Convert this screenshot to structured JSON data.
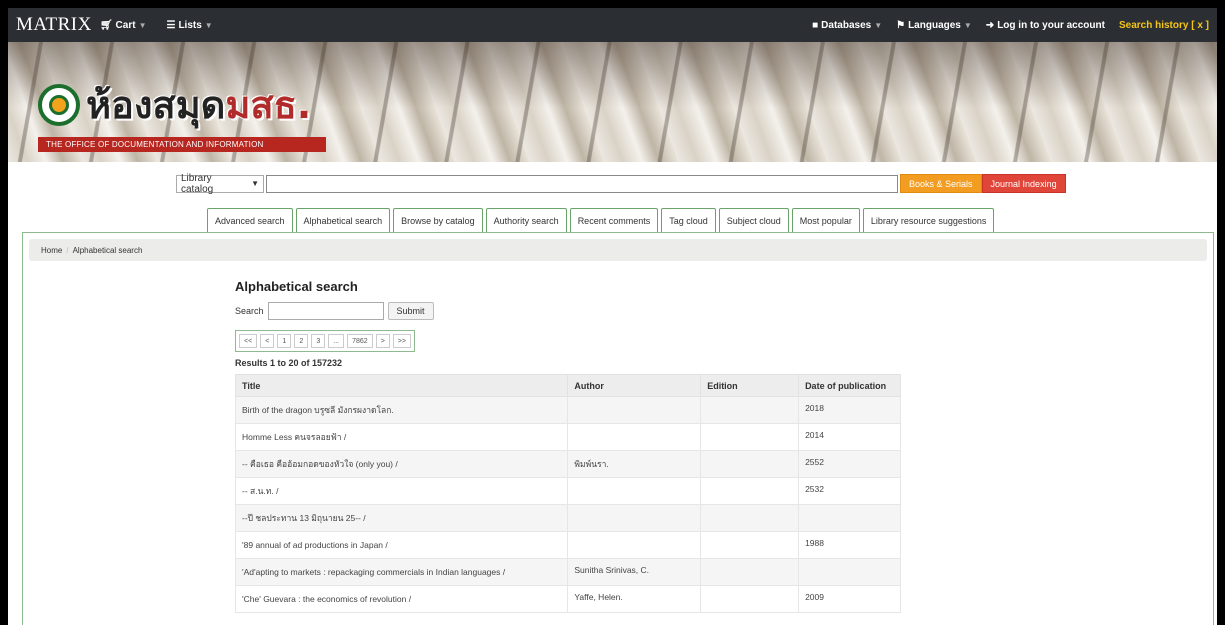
{
  "navbar": {
    "brand": "MATRIX",
    "cart": "Cart",
    "lists": "Lists",
    "databases": "Databases",
    "languages": "Languages",
    "login": "Log in to your account",
    "search_history": "Search history [ x ]"
  },
  "banner": {
    "logo_text": "ห้องสมุด",
    "logo_accent": "มสธ.",
    "logo_sub": "THE OFFICE OF DOCUMENTATION AND INFORMATION"
  },
  "search": {
    "catalog_select": "Library catalog",
    "query": "",
    "books_button": "Books & Serials",
    "journal_button": "Journal Indexing"
  },
  "tabs": [
    "Advanced search",
    "Alphabetical search",
    "Browse by catalog",
    "Authority search",
    "Recent comments",
    "Tag cloud",
    "Subject cloud",
    "Most popular",
    "Library resource suggestions"
  ],
  "breadcrumb": {
    "home": "Home",
    "current": "Alphabetical search"
  },
  "page": {
    "title": "Alphabetical search",
    "search_label": "Search",
    "search_value": "",
    "submit": "Submit",
    "results": "Results 1 to 20 of 157232"
  },
  "pager": [
    "<<",
    "<",
    "1",
    "2",
    "3",
    "...",
    "7862",
    ">",
    ">>"
  ],
  "table": {
    "headers": {
      "title": "Title",
      "author": "Author",
      "edition": "Edition",
      "date": "Date of publication"
    },
    "rows": [
      {
        "title": "Birth of the dragon บรูซลี มังกรผงาดโลก.",
        "author": "",
        "edition": "",
        "date": "2018"
      },
      {
        "title": "Homme Less คนจรลอยฟ้า /",
        "author": "",
        "edition": "",
        "date": "2014"
      },
      {
        "title": "-- คือเธอ คืออ้อมกอดของหัวใจ (only you) /",
        "author": "พิมพ์นรา.",
        "edition": "",
        "date": "2552"
      },
      {
        "title": "-- ส.น.ท. /",
        "author": "",
        "edition": "",
        "date": "2532"
      },
      {
        "title": "--ปี ชลประทาน 13 มิถุนายน 25-- /",
        "author": "",
        "edition": "",
        "date": ""
      },
      {
        "title": "'89 annual of ad productions in Japan /",
        "author": "",
        "edition": "",
        "date": "1988"
      },
      {
        "title": "'Ad'apting to markets : repackaging commercials in Indian languages /",
        "author": "Sunitha Srinivas, C.",
        "edition": "",
        "date": ""
      },
      {
        "title": "'Che' Guevara : the economics of revolution /",
        "author": "Yaffe, Helen.",
        "edition": "",
        "date": "2009"
      }
    ]
  }
}
